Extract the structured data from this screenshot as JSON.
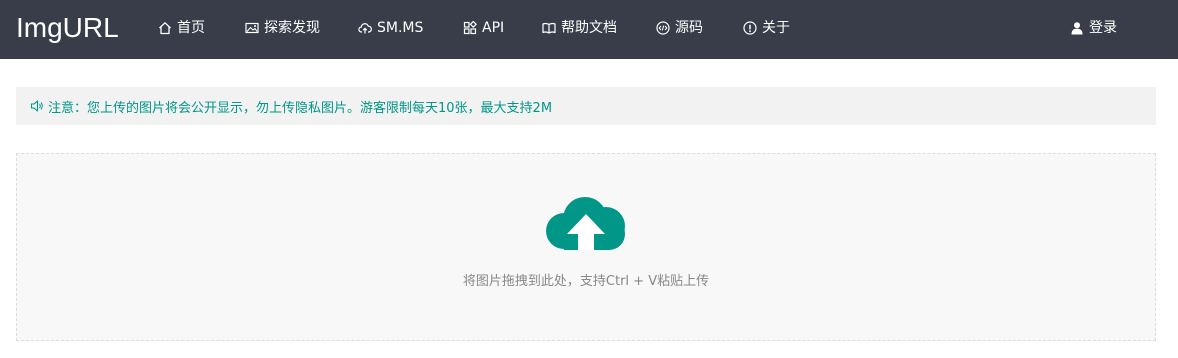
{
  "nav": {
    "brand": "ImgURL",
    "items": [
      {
        "label": "首页",
        "icon": "home-icon"
      },
      {
        "label": "探索发现",
        "icon": "image-icon"
      },
      {
        "label": "SM.MS",
        "icon": "cloud-upload-icon"
      },
      {
        "label": "API",
        "icon": "app-grid-icon"
      },
      {
        "label": "帮助文档",
        "icon": "book-icon"
      },
      {
        "label": "源码",
        "icon": "code-icon"
      },
      {
        "label": "关于",
        "icon": "info-icon"
      }
    ],
    "login": {
      "label": "登录",
      "icon": "user-icon"
    }
  },
  "notice": {
    "text": "注意：您上传的图片将会公开显示，勿上传隐私图片。游客限制每天10张，最大支持2M",
    "icon": "speaker-icon"
  },
  "upload": {
    "hint": "将图片拖拽到此处，支持Ctrl + V粘贴上传",
    "icon": "cloud-upload-icon"
  },
  "colors": {
    "navbar_bg": "#393d49",
    "accent": "#009688",
    "notice_bg": "#f2f2f2",
    "dropzone_bg": "#f8f8f8",
    "hint_text": "#888888"
  }
}
